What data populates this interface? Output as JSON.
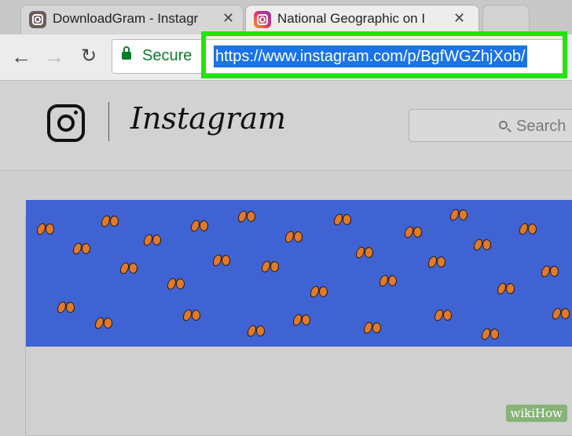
{
  "tabs": [
    {
      "title": "DownloadGram - Instagr"
    },
    {
      "title": "National Geographic on I"
    }
  ],
  "toolbar": {
    "secure_label": "Secure",
    "url": "https://www.instagram.com/p/BgfWGZhjXob/"
  },
  "instagram": {
    "wordmark": "Instagram",
    "search_placeholder": "Search"
  },
  "watermark": "wikiHow",
  "colors": {
    "highlight_border": "#21e40b",
    "url_selection": "#1a73e8",
    "secure_green": "#0a7d2c",
    "sky_blue": "#3f63d2"
  }
}
